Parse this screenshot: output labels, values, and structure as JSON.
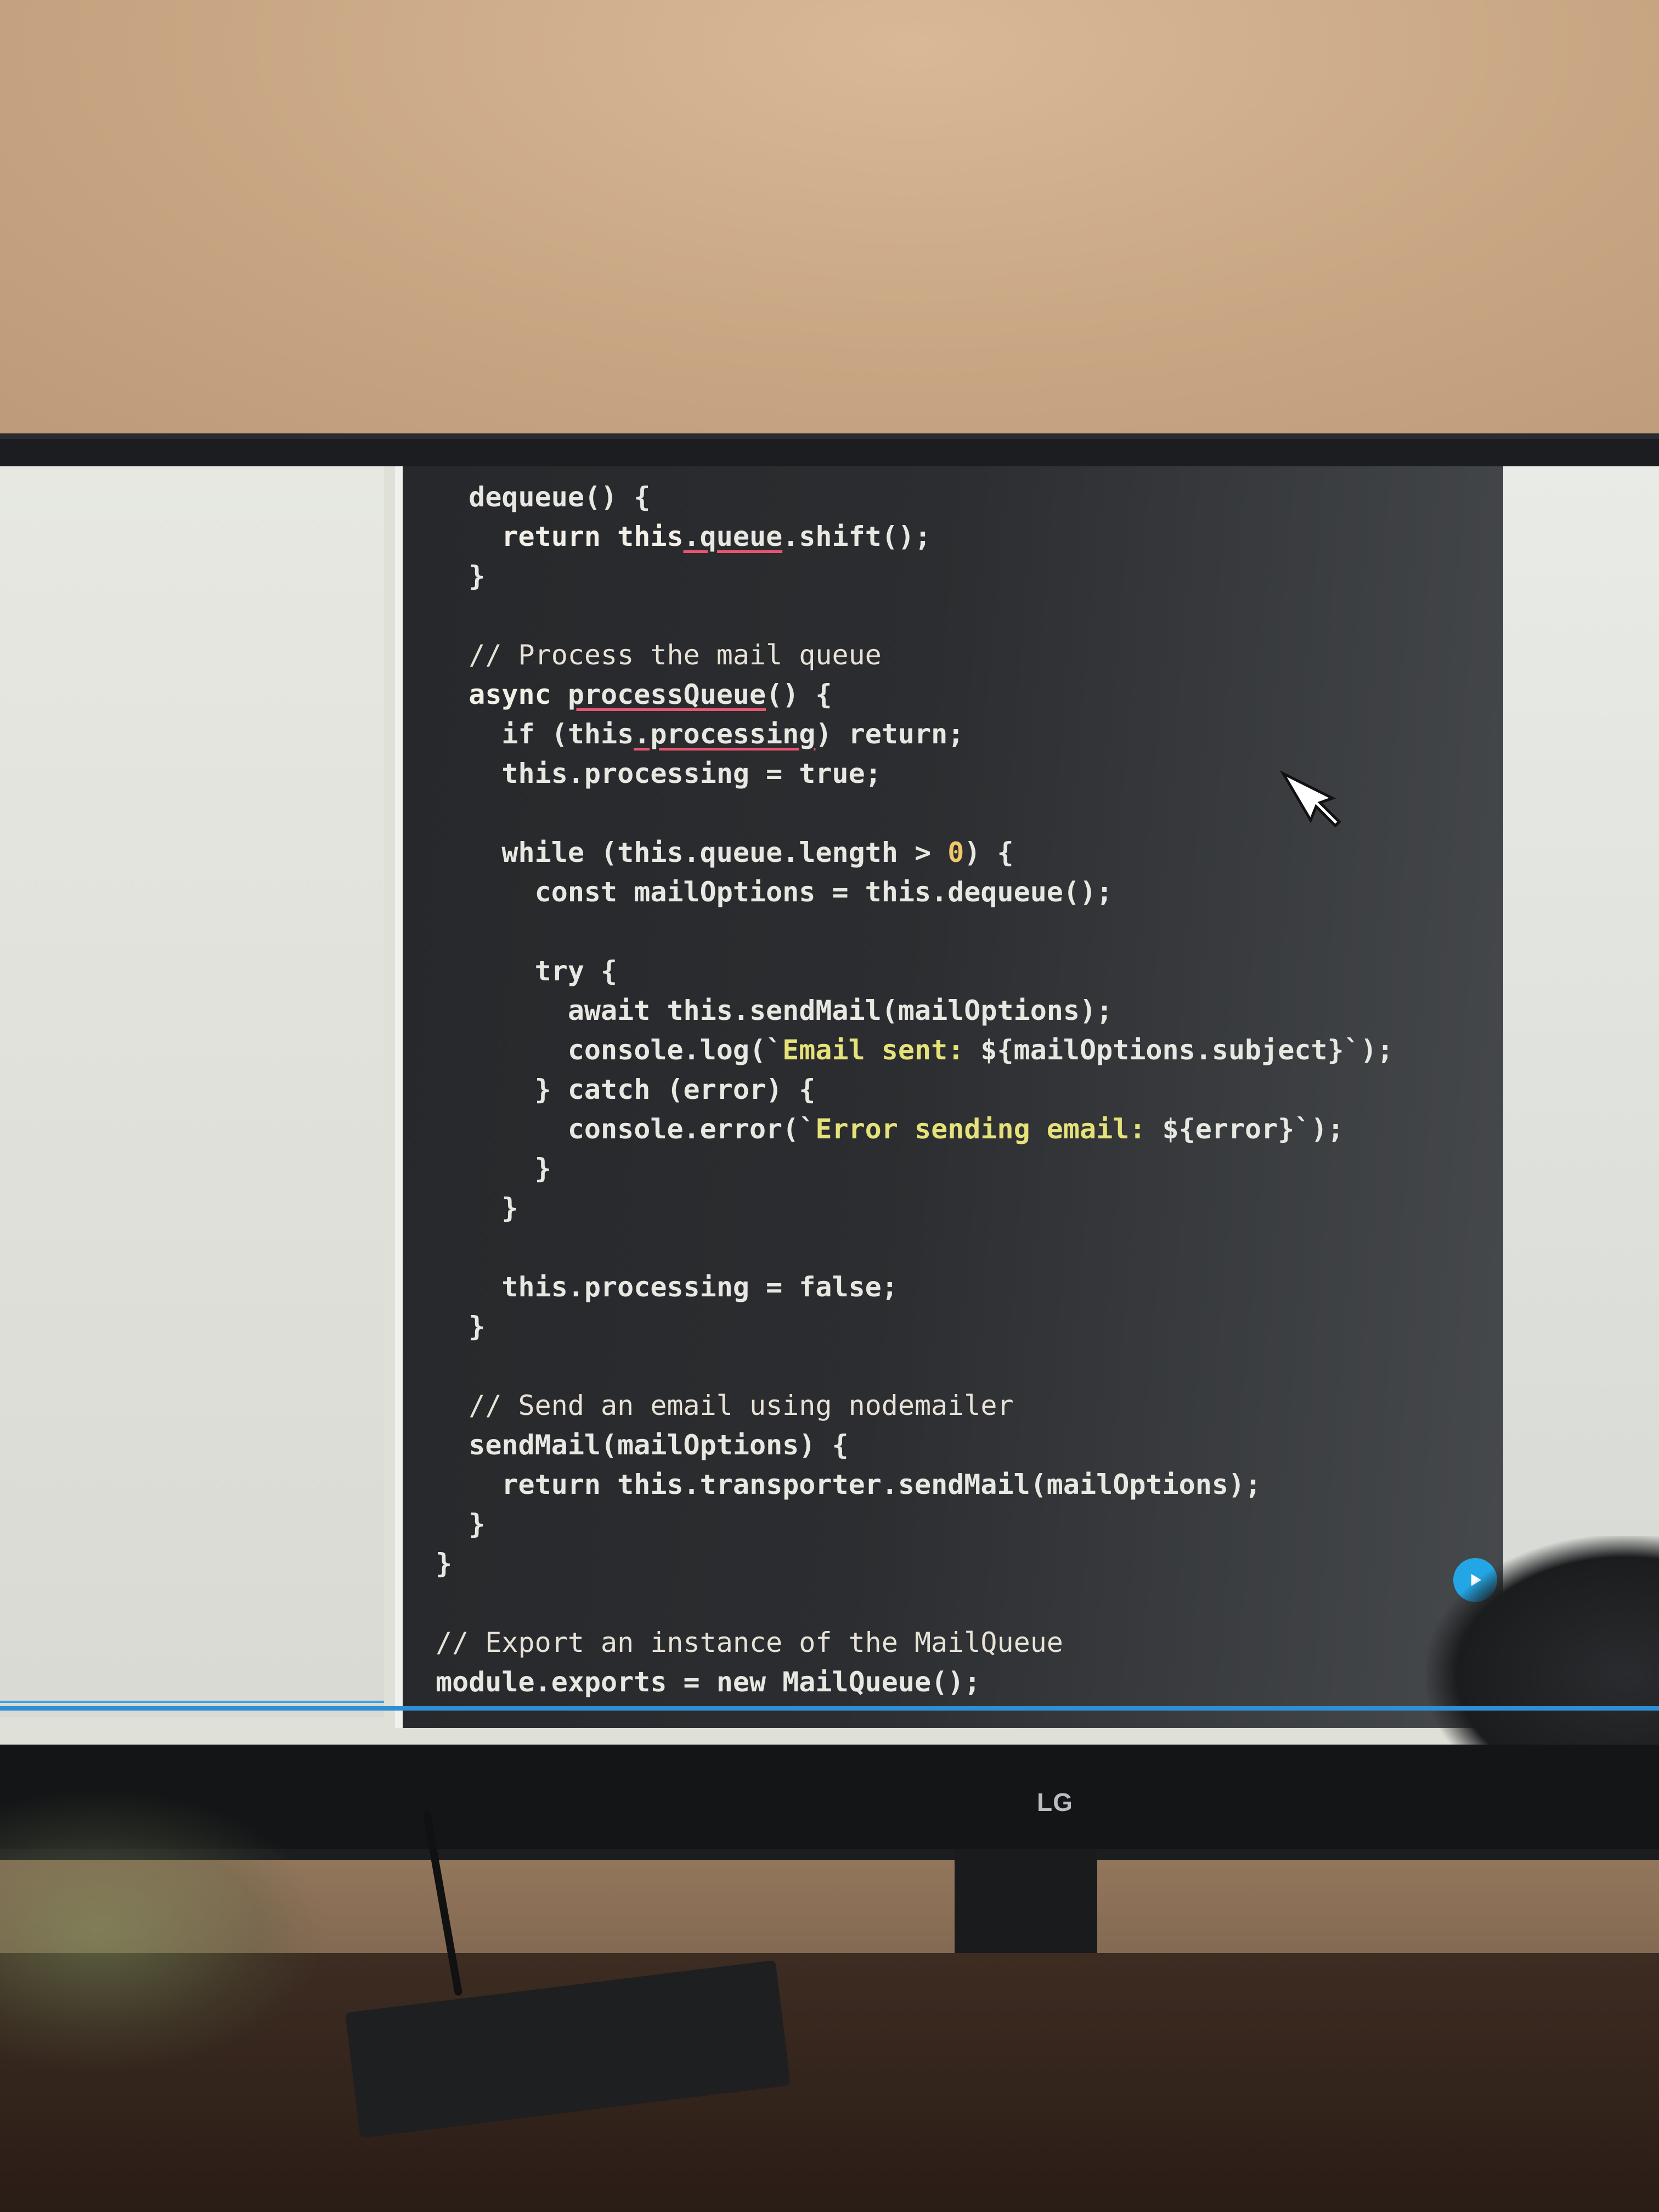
{
  "code_lines": [
    {
      "indent": 1,
      "parts": [
        {
          "t": "dequeue() {",
          "c": ""
        }
      ]
    },
    {
      "indent": 2,
      "parts": [
        {
          "t": "return this",
          "c": "c-kw"
        },
        {
          "t": ".queue",
          "c": "squig"
        },
        {
          "t": ".shift();",
          "c": ""
        }
      ]
    },
    {
      "indent": 1,
      "parts": [
        {
          "t": "}",
          "c": ""
        }
      ]
    },
    {
      "indent": 0,
      "parts": [
        {
          "t": "",
          "c": ""
        }
      ]
    },
    {
      "indent": 1,
      "parts": [
        {
          "t": "// Process the mail queue",
          "c": "c-com"
        }
      ]
    },
    {
      "indent": 1,
      "parts": [
        {
          "t": "async ",
          "c": "c-kw"
        },
        {
          "t": "processQueue",
          "c": "squig"
        },
        {
          "t": "() {",
          "c": ""
        }
      ]
    },
    {
      "indent": 2,
      "parts": [
        {
          "t": "if (this",
          "c": ""
        },
        {
          "t": ".processing",
          "c": "squig"
        },
        {
          "t": ") return;",
          "c": ""
        }
      ]
    },
    {
      "indent": 2,
      "parts": [
        {
          "t": "this.processing = true;",
          "c": ""
        }
      ]
    },
    {
      "indent": 0,
      "parts": [
        {
          "t": "",
          "c": ""
        }
      ]
    },
    {
      "indent": 2,
      "parts": [
        {
          "t": "while (this.queue.length > ",
          "c": ""
        },
        {
          "t": "0",
          "c": "c-num"
        },
        {
          "t": ") {",
          "c": ""
        }
      ]
    },
    {
      "indent": 3,
      "parts": [
        {
          "t": "const mailOptions = this.dequeue();",
          "c": ""
        }
      ]
    },
    {
      "indent": 0,
      "parts": [
        {
          "t": "",
          "c": ""
        }
      ]
    },
    {
      "indent": 3,
      "parts": [
        {
          "t": "try {",
          "c": ""
        }
      ]
    },
    {
      "indent": 4,
      "parts": [
        {
          "t": "await this.sendMail(mailOptions);",
          "c": ""
        }
      ]
    },
    {
      "indent": 4,
      "parts": [
        {
          "t": "console.log(`",
          "c": ""
        },
        {
          "t": "Email sent: ",
          "c": "c-str"
        },
        {
          "t": "${mailOptions.subject}`);",
          "c": ""
        }
      ]
    },
    {
      "indent": 3,
      "parts": [
        {
          "t": "} catch (error) {",
          "c": ""
        }
      ]
    },
    {
      "indent": 4,
      "parts": [
        {
          "t": "console.error(`",
          "c": ""
        },
        {
          "t": "Error sending email: ",
          "c": "c-str"
        },
        {
          "t": "${error}`);",
          "c": ""
        }
      ]
    },
    {
      "indent": 3,
      "parts": [
        {
          "t": "}",
          "c": ""
        }
      ]
    },
    {
      "indent": 2,
      "parts": [
        {
          "t": "}",
          "c": ""
        }
      ]
    },
    {
      "indent": 0,
      "parts": [
        {
          "t": "",
          "c": ""
        }
      ]
    },
    {
      "indent": 2,
      "parts": [
        {
          "t": "this.processing = false;",
          "c": ""
        }
      ]
    },
    {
      "indent": 1,
      "parts": [
        {
          "t": "}",
          "c": ""
        }
      ]
    },
    {
      "indent": 0,
      "parts": [
        {
          "t": "",
          "c": ""
        }
      ]
    },
    {
      "indent": 1,
      "parts": [
        {
          "t": "// Send an email using nodemailer",
          "c": "c-com"
        }
      ]
    },
    {
      "indent": 1,
      "parts": [
        {
          "t": "sendMail(mailOptions) {",
          "c": ""
        }
      ]
    },
    {
      "indent": 2,
      "parts": [
        {
          "t": "return this.transporter.sendMail(mailOptions);",
          "c": ""
        }
      ]
    },
    {
      "indent": 1,
      "parts": [
        {
          "t": "}",
          "c": ""
        }
      ]
    },
    {
      "indent": 0,
      "parts": [
        {
          "t": "}",
          "c": ""
        }
      ]
    },
    {
      "indent": 0,
      "parts": [
        {
          "t": "",
          "c": ""
        }
      ]
    },
    {
      "indent": 0,
      "parts": [
        {
          "t": "// Export an instance of the MailQueue",
          "c": "c-com"
        }
      ]
    },
    {
      "indent": 0,
      "parts": [
        {
          "t": "module.exports = new MailQueue();",
          "c": ""
        }
      ]
    }
  ],
  "monitor": {
    "brand": "LG"
  },
  "icons": {
    "cursor": "pointer-cursor-icon",
    "play": "play-icon"
  },
  "colors": {
    "accent": "#2f8fd2",
    "play": "#23a6e6",
    "squiggle": "#e8546f",
    "string": "#e6e27a"
  }
}
